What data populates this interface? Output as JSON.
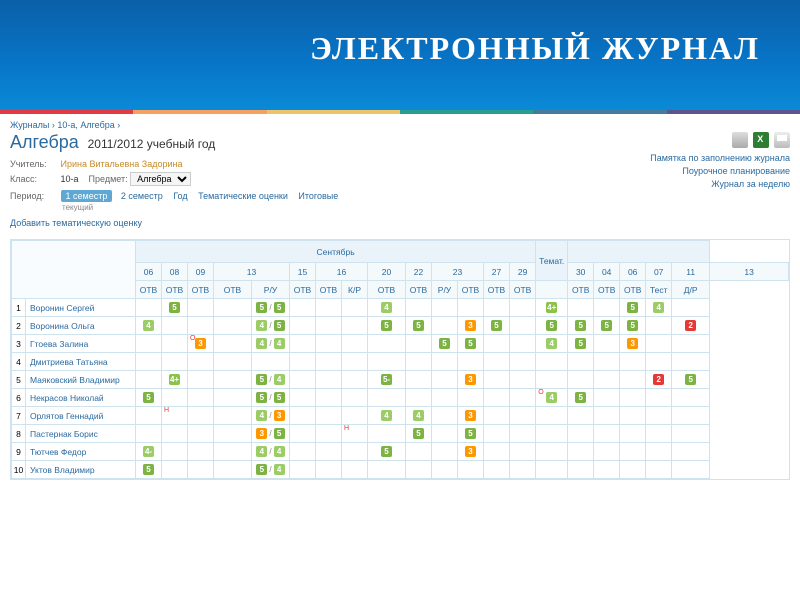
{
  "banner_title": "ЭЛЕКТРОННЫЙ ЖУРНАЛ",
  "breadcrumbs": [
    "Журналы",
    "10-а, Алгебра"
  ],
  "subject": "Алгебра",
  "year": "2011/2012 учебный год",
  "meta": {
    "teacher_label": "Учитель:",
    "teacher": "Ирина Витальевна Задорина",
    "class_label": "Класс:",
    "class": "10-а",
    "subject_label": "Предмет:",
    "subject_select": "Алгебра"
  },
  "periods": {
    "label": "Период:",
    "active": "1 семестр",
    "items": [
      "2 семестр",
      "Год",
      "Тематические оценки",
      "Итоговые"
    ],
    "sub": "текущий"
  },
  "add_thematic": "Добавить тематическую оценку",
  "rlinks": [
    "Памятка по заполнению журнала",
    "Поурочное планирование",
    "Журнал за неделю"
  ],
  "month": "Сентябрь",
  "dates": [
    "06",
    "08",
    "09",
    "13",
    "15",
    "16",
    "20",
    "22",
    "23",
    "27",
    "29",
    "30"
  ],
  "types": [
    "ОТВ",
    "ОТВ",
    "ОТВ",
    "ОТВ",
    "Р/У",
    "ОТВ",
    "ОТВ",
    "К/Р",
    "ОТВ",
    "ОТВ",
    "Р/У",
    "ОТВ",
    "ОТВ",
    "ОТВ"
  ],
  "tem_label": "Темат.",
  "dates2": [
    "04",
    "06",
    "07",
    "11",
    "13"
  ],
  "types2": [
    "ОТВ",
    "ОТВ",
    "ОТВ",
    "Тест",
    "Д/Р"
  ],
  "students": [
    {
      "n": 1,
      "name": "Воронин Сергей",
      "cells": {
        "1": [
          "5"
        ],
        "4": [
          "5",
          "5"
        ],
        "8": [
          "4"
        ],
        "tem": [
          "4+"
        ],
        "d3": [
          "5"
        ],
        "d4": [
          "4"
        ]
      }
    },
    {
      "n": 2,
      "name": "Воронина Ольга",
      "cells": {
        "0": [
          "4"
        ],
        "4": [
          "4",
          "5"
        ],
        "8": [
          "5"
        ],
        "9": [
          "5"
        ],
        "11": [
          "3"
        ],
        "12": [
          "5"
        ],
        "tem": [
          "5"
        ],
        "d1": [
          "5"
        ],
        "d2": [
          "5"
        ],
        "d3": [
          "5"
        ],
        "d5": [
          "2"
        ]
      }
    },
    {
      "n": 3,
      "name": "Гтоева Залина",
      "cells": {
        "2f": "О",
        "2": [
          "3"
        ],
        "4": [
          "4",
          "4"
        ],
        "10": [
          "5"
        ],
        "11": [
          "5"
        ],
        "tem": [
          "4"
        ],
        "d1": [
          "5"
        ],
        "d3": [
          "3"
        ]
      }
    },
    {
      "n": 4,
      "name": "Дмитриева Татьяна",
      "cells": {}
    },
    {
      "n": 5,
      "name": "Маяковский Владимир",
      "cells": {
        "1": [
          "4+"
        ],
        "4": [
          "5",
          "4"
        ],
        "8": [
          "5-"
        ],
        "11": [
          "3"
        ],
        "d4": [
          "2"
        ],
        "d5": [
          "5"
        ]
      }
    },
    {
      "n": 6,
      "name": "Некрасов Николай",
      "cells": {
        "0": [
          "5"
        ],
        "4": [
          "5",
          "5"
        ],
        "tem": [
          "4"
        ],
        "temf": "О",
        "d1": [
          "5"
        ]
      }
    },
    {
      "n": 7,
      "name": "Орлятов Геннадий",
      "cells": {
        "1f": "Н",
        "4": [
          "4",
          "3"
        ],
        "8": [
          "4"
        ],
        "9": [
          "4"
        ],
        "11": [
          "3"
        ]
      }
    },
    {
      "n": 8,
      "name": "Пастернак Борис",
      "cells": {
        "4": [
          "3",
          "5"
        ],
        "7f": "Н",
        "9": [
          "5"
        ],
        "11": [
          "5"
        ]
      }
    },
    {
      "n": 9,
      "name": "Тютчев Федор",
      "cells": {
        "0": [
          "4-"
        ],
        "4": [
          "4",
          "4"
        ],
        "8": [
          "5"
        ],
        "11": [
          "3"
        ]
      }
    },
    {
      "n": 10,
      "name": "Уктов Владимир",
      "cells": {
        "0": [
          "5"
        ],
        "4": [
          "5",
          "4"
        ]
      }
    }
  ]
}
